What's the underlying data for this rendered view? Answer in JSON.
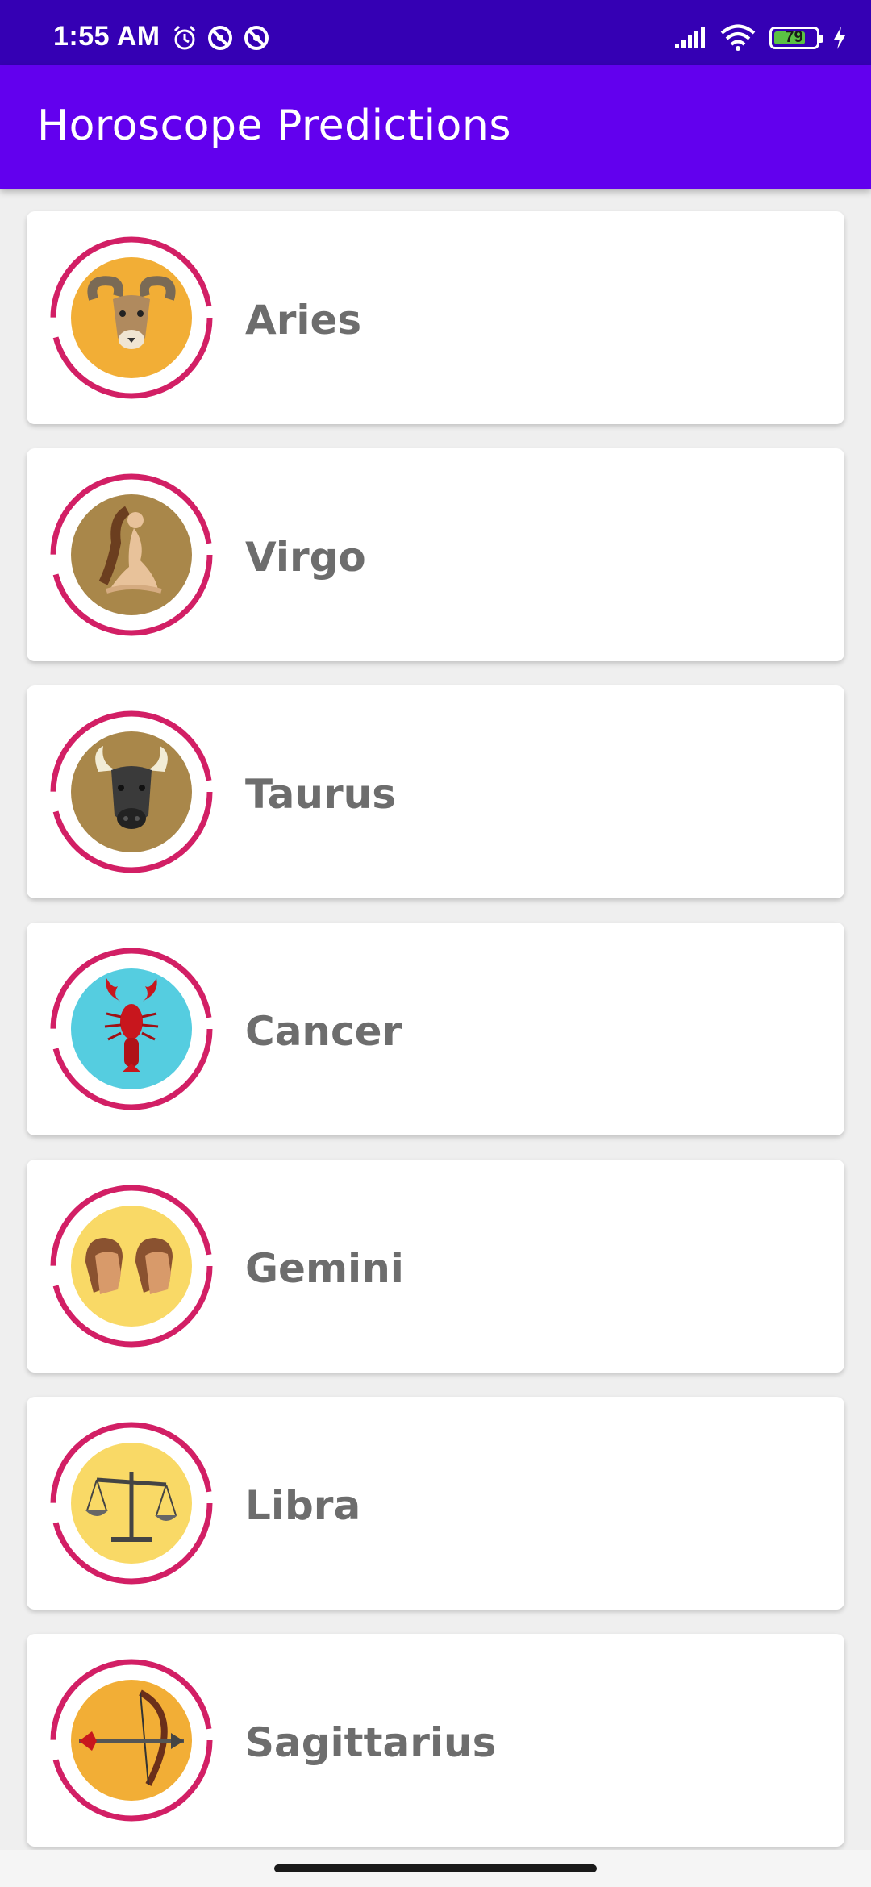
{
  "status_bar": {
    "time": "1:55 AM",
    "battery_level": "79",
    "left_icons": [
      "alarm-icon",
      "do-not-disturb-icon",
      "do-not-disturb-icon"
    ],
    "right_icons": [
      "cell-signal-icon",
      "wifi-icon",
      "battery-icon",
      "charging-icon"
    ]
  },
  "app_bar": {
    "title": "Horoscope Predictions"
  },
  "signs": [
    {
      "name": "Aries",
      "icon": "ram-icon",
      "bg": "#f2ae36"
    },
    {
      "name": "Virgo",
      "icon": "maiden-icon",
      "bg": "#a9874a"
    },
    {
      "name": "Taurus",
      "icon": "bull-icon",
      "bg": "#a9874a"
    },
    {
      "name": "Cancer",
      "icon": "lobster-icon",
      "bg": "#55cde0"
    },
    {
      "name": "Gemini",
      "icon": "twins-icon",
      "bg": "#f9d966"
    },
    {
      "name": "Libra",
      "icon": "scales-icon",
      "bg": "#f9d966"
    },
    {
      "name": "Sagittarius",
      "icon": "bow-and-arrow-icon",
      "bg": "#f2ae36"
    }
  ],
  "colors": {
    "status_bar": "#3500b4",
    "app_bar": "#6200ee",
    "ring": "#d21f65",
    "label": "#6d6d6d"
  }
}
